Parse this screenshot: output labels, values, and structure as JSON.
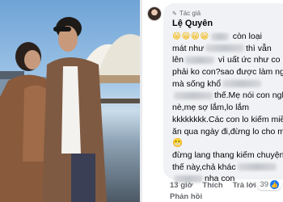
{
  "comment": {
    "badge": "Tác giả",
    "author": "Lệ Quyên",
    "lines": [
      {
        "pre": "",
        "emoji": "😁😁😁😁",
        "post": " còn loại"
      },
      {
        "pre": "mát như",
        "post": "thì vẫn"
      },
      {
        "pre": "lên",
        "post": " vì uất ức như co"
      },
      {
        "pre": "phải ko con?sao được làm ngh"
      },
      {
        "pre": "mà sống khổ"
      },
      {
        "pre": "",
        "post": "thế.Mẹ nói con nghe"
      },
      {
        "pre": "nè,mẹ sợ lắm,lo lắm"
      },
      {
        "pre": "kkkkkkkk.Các con lo kiếm miề"
      },
      {
        "pre": "ăn qua ngày đi,đừng lo cho m"
      },
      {
        "pre": "",
        "emoji": "😬"
      },
      {
        "pre": "đừng lang thang kiếm chuyện"
      },
      {
        "pre": "thế này,chả khác"
      },
      {
        "pre": "",
        "post": "nha con"
      }
    ],
    "time": "13 giờ",
    "like_label": "Thích",
    "reply_label": "Trả lời",
    "reply_row": "Phản hồi",
    "reaction_count": "39",
    "reaction_icon": "like-icon"
  }
}
